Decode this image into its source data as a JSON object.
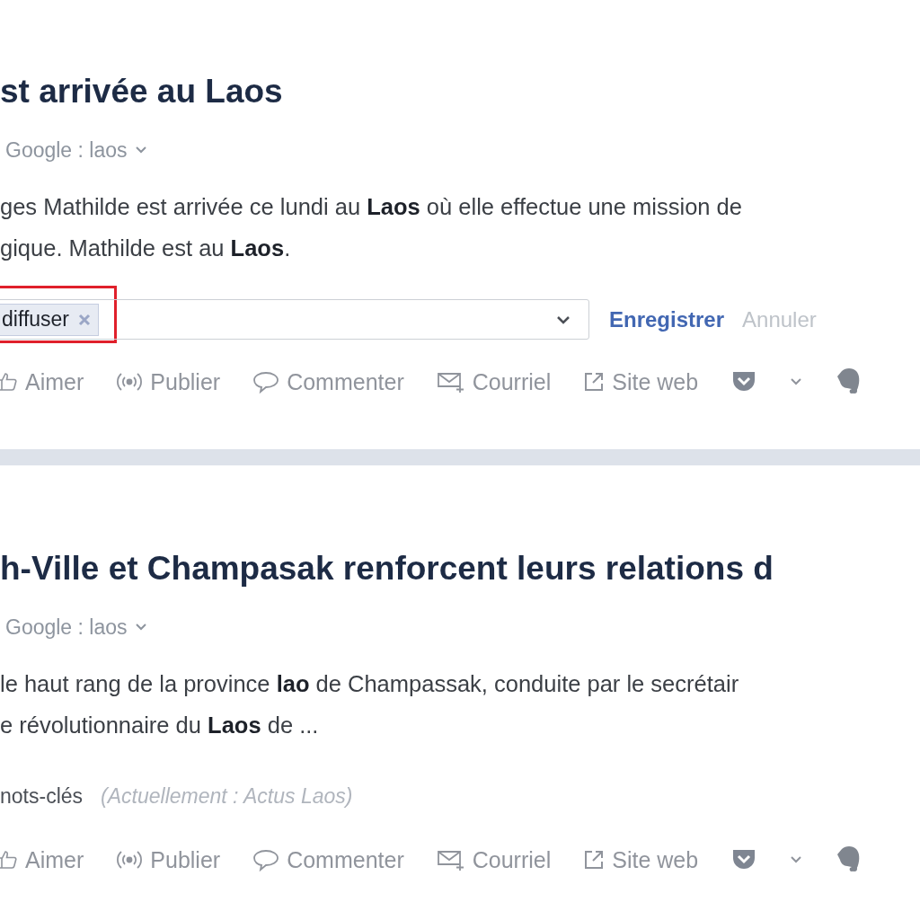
{
  "articles": [
    {
      "title": "st arrivée au Laos",
      "source": "Google : laos",
      "snippet_lines": [
        "ges Mathilde est arrivée ce lundi au **Laos** où elle effectue une mission de",
        "gique. Mathilde est au **Laos**."
      ],
      "tag_editor": {
        "tags": [
          {
            "label": "diffuser",
            "highlighted": true
          }
        ],
        "save": "Enregistrer",
        "cancel": "Annuler"
      },
      "actions": [
        {
          "kind": "like",
          "label": "Aimer"
        },
        {
          "kind": "publish",
          "label": "Publier"
        },
        {
          "kind": "comment",
          "label": "Commenter"
        },
        {
          "kind": "email",
          "label": "Courriel"
        },
        {
          "kind": "website",
          "label": "Site web"
        },
        {
          "kind": "pocket"
        },
        {
          "kind": "evernote"
        }
      ]
    },
    {
      "title": "h-Ville et Champasak renforcent leurs relations d",
      "source": "Google : laos",
      "snippet_lines": [
        "le haut rang de la province **lao** de Champassak, conduite par le secrétair",
        "e révolutionnaire du **Laos** de ..."
      ],
      "keywords": {
        "label": "nots-clés",
        "current": "(Actuellement : Actus Laos)"
      },
      "actions": [
        {
          "kind": "like",
          "label": "Aimer"
        },
        {
          "kind": "publish",
          "label": "Publier"
        },
        {
          "kind": "comment",
          "label": "Commenter"
        },
        {
          "kind": "email",
          "label": "Courriel"
        },
        {
          "kind": "website",
          "label": "Site web"
        },
        {
          "kind": "pocket"
        },
        {
          "kind": "evernote"
        }
      ]
    }
  ]
}
